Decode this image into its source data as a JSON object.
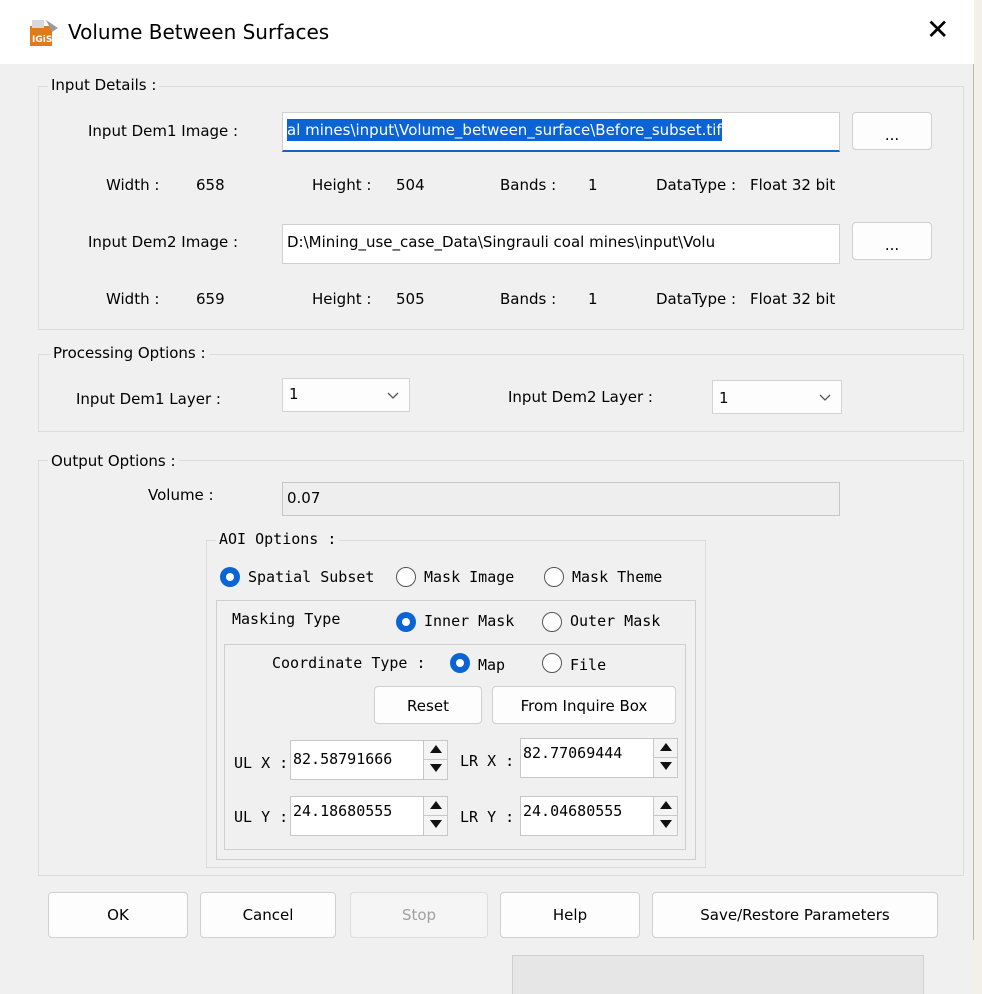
{
  "window": {
    "title": "Volume Between Surfaces",
    "close_glyph": "✕",
    "app_icon_text": "IGiS"
  },
  "input_details": {
    "title": "Input Details :",
    "dem1": {
      "label": "Input Dem1 Image :",
      "path_display": "al mines\\input\\Volume_between_surface\\Before_subset.tif",
      "browse_label": "...",
      "width_label": "Width :",
      "width_value": "658",
      "height_label": "Height :",
      "height_value": "504",
      "bands_label": "Bands :",
      "bands_value": "1",
      "datatype_label": "DataType :",
      "datatype_value": "Float 32 bit"
    },
    "dem2": {
      "label": "Input Dem2 Image :",
      "path_display": "D:\\Mining_use_case_Data\\Singrauli coal mines\\input\\Volu",
      "browse_label": "...",
      "width_label": "Width :",
      "width_value": "659",
      "height_label": "Height :",
      "height_value": "505",
      "bands_label": "Bands :",
      "bands_value": "1",
      "datatype_label": "DataType :",
      "datatype_value": "Float 32 bit"
    }
  },
  "processing_options": {
    "title": "Processing Options :",
    "dem1_layer_label": "Input Dem1 Layer :",
    "dem1_layer_value": "1",
    "dem2_layer_label": "Input Dem2 Layer :",
    "dem2_layer_value": "1"
  },
  "output_options": {
    "title": "Output Options :",
    "volume_label": "Volume :",
    "volume_value": "0.07",
    "aoi": {
      "title": "AOI Options :",
      "options": [
        "Spatial Subset",
        "Mask Image",
        "Mask Theme"
      ],
      "selected": "Spatial Subset",
      "masking_type_label": "Masking Type",
      "mask_options": [
        "Inner Mask",
        "Outer Mask"
      ],
      "mask_selected": "Inner Mask",
      "coordinate_type_label": "Coordinate Type :",
      "coord_options": [
        "Map",
        "File"
      ],
      "coord_selected": "Map",
      "reset_label": "Reset",
      "inquire_label": "From Inquire Box",
      "ulx_label": "UL X :",
      "ulx_value": "82.58791666",
      "lrx_label": "LR X :",
      "lrx_value": "82.77069444",
      "uly_label": "UL Y :",
      "uly_value": "24.18680555",
      "lry_label": "LR Y :",
      "lry_value": "24.04680555"
    }
  },
  "buttons": {
    "ok": "OK",
    "cancel": "Cancel",
    "stop": "Stop",
    "help": "Help",
    "save_restore": "Save/Restore Parameters"
  },
  "colors": {
    "accent": "#0a64d6",
    "dialog_bg": "#f0f0f0",
    "title_bg": "#ffffff"
  }
}
